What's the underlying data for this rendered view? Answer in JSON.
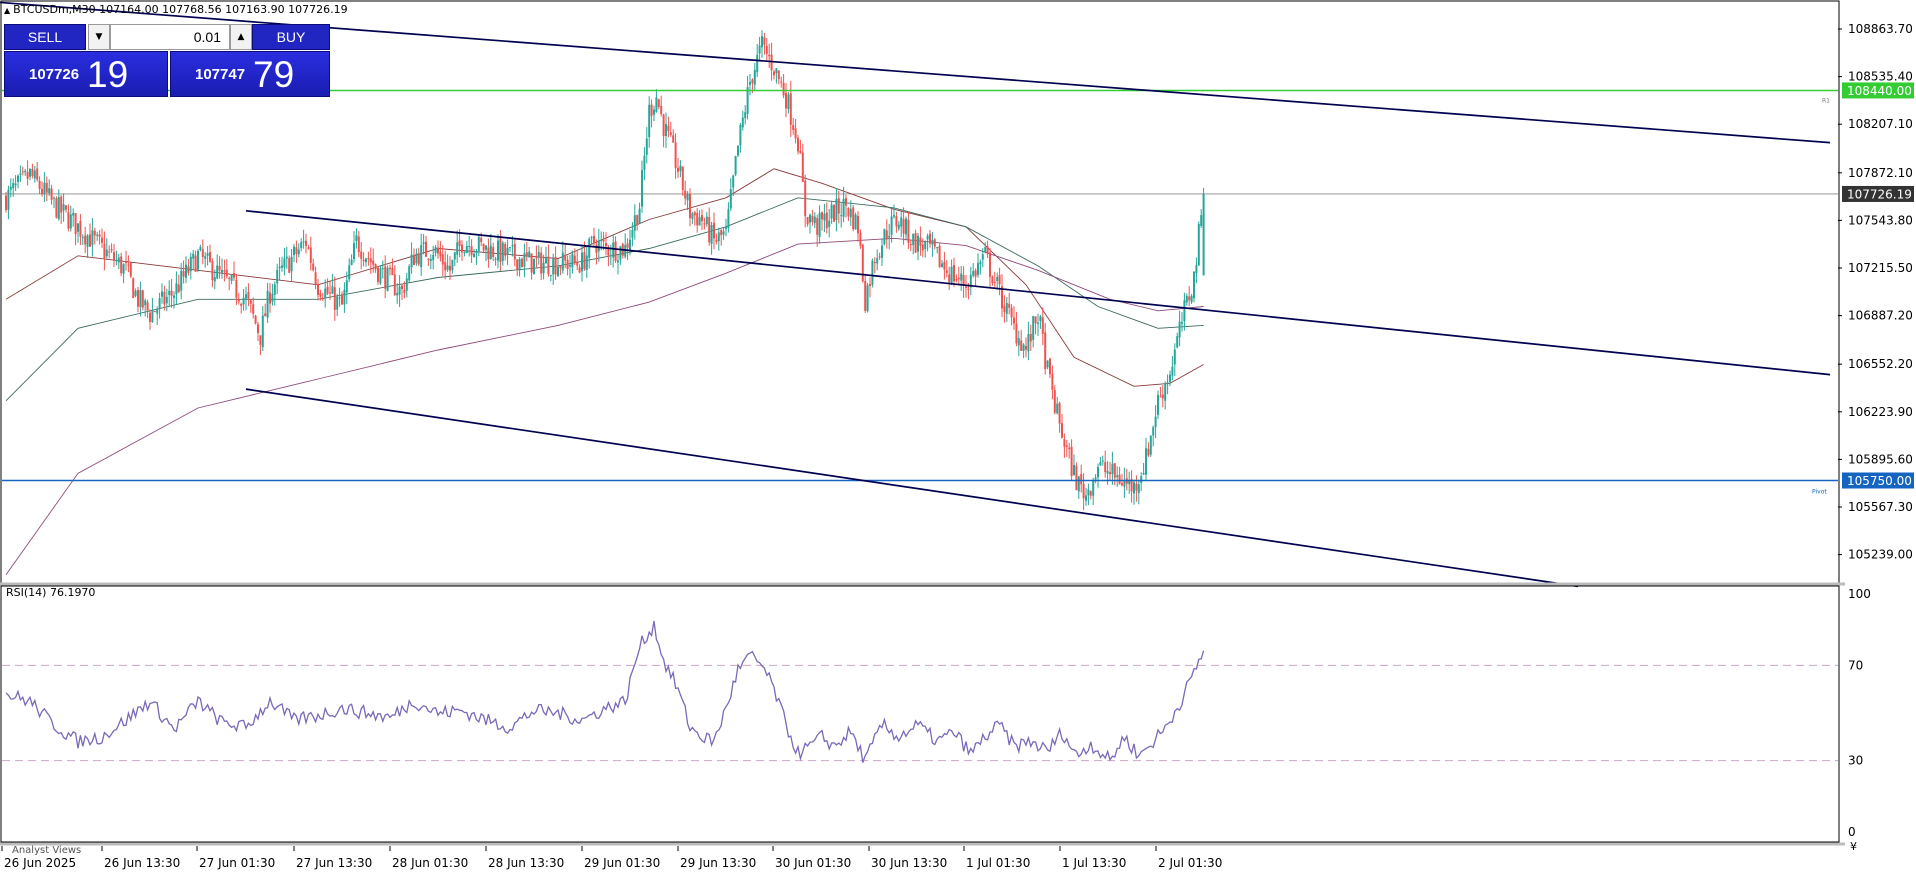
{
  "symbol_header": "BTCUSDm,M30  107164.00 107768.56 107163.90 107726.19",
  "trade_panel": {
    "sell_label": "SELL",
    "buy_label": "BUY",
    "lot": "0.01",
    "sell_price_main": "107726",
    "sell_price_big": "19",
    "buy_price_main": "107747",
    "buy_price_big": "79"
  },
  "indicator_label": "RSI(14) 76.1970",
  "bottom_tab": "Analyst Views",
  "price_axis_labels": [
    "108863.70",
    "108535.40",
    "108207.10",
    "107872.10",
    "107543.80",
    "107215.50",
    "106887.20",
    "106552.20",
    "106223.90",
    "105895.60",
    "105567.30",
    "105239.00"
  ],
  "rsi_axis_labels": [
    "100",
    "70",
    "30",
    "0"
  ],
  "time_axis_labels": [
    "26 Jun 2025",
    "26 Jun 13:30",
    "27 Jun 01:30",
    "27 Jun 13:30",
    "28 Jun 01:30",
    "28 Jun 13:30",
    "29 Jun 01:30",
    "29 Jun 13:30",
    "30 Jun 01:30",
    "30 Jun 13:30",
    "1 Jul 01:30",
    "1 Jul 13:30",
    "2 Jul 01:30"
  ],
  "current_price_label": "107726.19",
  "resistance_label": "108440.00",
  "pivot_label": "105750.00",
  "r1_tag": "R1",
  "pivot_tag": "Pivot",
  "colors": {
    "bull": "#26a69a",
    "bear": "#ef5350",
    "resistance": "#33cc33",
    "pivot": "#1565c0",
    "rsi": "#7b68b8",
    "channel": "#000050"
  },
  "chart_data": {
    "type": "candlestick",
    "symbol": "BTCUSDm",
    "timeframe": "M30",
    "ylim": [
      105050,
      109050
    ],
    "open": 107164.0,
    "high": 107768.56,
    "low": 107163.9,
    "close": 107726.19,
    "price_path": [
      [
        0,
        107700
      ],
      [
        10,
        107860
      ],
      [
        20,
        107650
      ],
      [
        30,
        107500
      ],
      [
        40,
        107350
      ],
      [
        50,
        107200
      ],
      [
        55,
        107000
      ],
      [
        60,
        106900
      ],
      [
        70,
        107050
      ],
      [
        80,
        107300
      ],
      [
        90,
        107150
      ],
      [
        100,
        107000
      ],
      [
        106,
        106750
      ],
      [
        110,
        107050
      ],
      [
        115,
        107200
      ],
      [
        125,
        107400
      ],
      [
        130,
        107100
      ],
      [
        140,
        106950
      ],
      [
        146,
        107400
      ],
      [
        155,
        107200
      ],
      [
        165,
        107050
      ],
      [
        170,
        107300
      ],
      [
        178,
        107350
      ],
      [
        185,
        107200
      ],
      [
        190,
        107400
      ],
      [
        200,
        107350
      ],
      [
        210,
        107300
      ],
      [
        220,
        107250
      ],
      [
        230,
        107250
      ],
      [
        240,
        107250
      ],
      [
        245,
        107400
      ],
      [
        250,
        107350
      ],
      [
        258,
        107350
      ],
      [
        264,
        107650
      ],
      [
        268,
        108300
      ],
      [
        271,
        108400
      ],
      [
        274,
        108200
      ],
      [
        280,
        107900
      ],
      [
        285,
        107600
      ],
      [
        290,
        107550
      ],
      [
        295,
        107400
      ],
      [
        300,
        107450
      ],
      [
        305,
        108050
      ],
      [
        310,
        108500
      ],
      [
        315,
        108750
      ],
      [
        320,
        108600
      ],
      [
        325,
        108400
      ],
      [
        330,
        108100
      ],
      [
        333,
        107600
      ],
      [
        338,
        107500
      ],
      [
        345,
        107600
      ],
      [
        350,
        107650
      ],
      [
        355,
        107500
      ],
      [
        358,
        107000
      ],
      [
        362,
        107300
      ],
      [
        368,
        107500
      ],
      [
        372,
        107550
      ],
      [
        378,
        107400
      ],
      [
        385,
        107350
      ],
      [
        392,
        107200
      ],
      [
        400,
        107100
      ],
      [
        408,
        107300
      ],
      [
        415,
        107000
      ],
      [
        420,
        106800
      ],
      [
        425,
        106650
      ],
      [
        430,
        106900
      ],
      [
        434,
        106500
      ],
      [
        438,
        106200
      ],
      [
        442,
        105950
      ],
      [
        446,
        105750
      ],
      [
        450,
        105650
      ],
      [
        455,
        105850
      ],
      [
        460,
        105800
      ],
      [
        465,
        105750
      ],
      [
        470,
        105700
      ],
      [
        475,
        105900
      ],
      [
        480,
        106300
      ],
      [
        485,
        106500
      ],
      [
        490,
        106850
      ],
      [
        495,
        107150
      ],
      [
        499,
        107726
      ]
    ],
    "rsi": [
      [
        0,
        58
      ],
      [
        10,
        55
      ],
      [
        20,
        45
      ],
      [
        30,
        38
      ],
      [
        40,
        40
      ],
      [
        50,
        47
      ],
      [
        60,
        55
      ],
      [
        70,
        43
      ],
      [
        80,
        55
      ],
      [
        90,
        46
      ],
      [
        100,
        44
      ],
      [
        110,
        55
      ],
      [
        120,
        47
      ],
      [
        130,
        49
      ],
      [
        140,
        52
      ],
      [
        150,
        50
      ],
      [
        160,
        48
      ],
      [
        170,
        55
      ],
      [
        180,
        50
      ],
      [
        190,
        51
      ],
      [
        200,
        47
      ],
      [
        210,
        44
      ],
      [
        220,
        51
      ],
      [
        230,
        50
      ],
      [
        240,
        47
      ],
      [
        250,
        52
      ],
      [
        258,
        55
      ],
      [
        264,
        78
      ],
      [
        270,
        87
      ],
      [
        274,
        72
      ],
      [
        280,
        60
      ],
      [
        285,
        44
      ],
      [
        290,
        40
      ],
      [
        295,
        38
      ],
      [
        300,
        52
      ],
      [
        305,
        68
      ],
      [
        310,
        74
      ],
      [
        315,
        70
      ],
      [
        320,
        60
      ],
      [
        325,
        45
      ],
      [
        330,
        33
      ],
      [
        335,
        36
      ],
      [
        340,
        40
      ],
      [
        345,
        36
      ],
      [
        352,
        42
      ],
      [
        358,
        30
      ],
      [
        365,
        45
      ],
      [
        372,
        40
      ],
      [
        380,
        45
      ],
      [
        388,
        38
      ],
      [
        395,
        42
      ],
      [
        402,
        33
      ],
      [
        408,
        40
      ],
      [
        414,
        45
      ],
      [
        420,
        36
      ],
      [
        427,
        38
      ],
      [
        434,
        34
      ],
      [
        440,
        42
      ],
      [
        446,
        32
      ],
      [
        452,
        37
      ],
      [
        460,
        30
      ],
      [
        466,
        40
      ],
      [
        472,
        32
      ],
      [
        478,
        38
      ],
      [
        484,
        45
      ],
      [
        490,
        56
      ],
      [
        495,
        67
      ],
      [
        499,
        76.197
      ]
    ],
    "levels": {
      "resistance": 108440.0,
      "pivot": 105750.0,
      "current": 107726.19
    },
    "rsi_levels": [
      70,
      30
    ],
    "rsi_ylim": [
      0,
      100
    ],
    "channel_lines": [
      {
        "from": [
          -5,
          109050
        ],
        "to": [
          760,
          108080
        ]
      },
      {
        "from": [
          100,
          107610
        ],
        "to": [
          760,
          106480
        ]
      },
      {
        "from": [
          100,
          106380
        ],
        "to": [
          655,
          105020
        ]
      }
    ],
    "moving_averages": {
      "fast": [
        [
          0,
          107000
        ],
        [
          30,
          107300
        ],
        [
          80,
          107200
        ],
        [
          130,
          107100
        ],
        [
          180,
          107350
        ],
        [
          230,
          107280
        ],
        [
          268,
          107550
        ],
        [
          300,
          107700
        ],
        [
          320,
          107900
        ],
        [
          340,
          107800
        ],
        [
          370,
          107620
        ],
        [
          400,
          107500
        ],
        [
          425,
          107100
        ],
        [
          445,
          106600
        ],
        [
          470,
          106400
        ],
        [
          485,
          106420
        ],
        [
          499,
          106550
        ]
      ],
      "medium": [
        [
          0,
          106300
        ],
        [
          30,
          106800
        ],
        [
          80,
          107000
        ],
        [
          130,
          107000
        ],
        [
          180,
          107150
        ],
        [
          230,
          107230
        ],
        [
          268,
          107350
        ],
        [
          300,
          107500
        ],
        [
          330,
          107700
        ],
        [
          370,
          107630
        ],
        [
          400,
          107500
        ],
        [
          430,
          107230
        ],
        [
          455,
          106950
        ],
        [
          480,
          106800
        ],
        [
          499,
          106820
        ]
      ],
      "slow": [
        [
          0,
          105100
        ],
        [
          30,
          105800
        ],
        [
          80,
          106250
        ],
        [
          130,
          106450
        ],
        [
          180,
          106650
        ],
        [
          230,
          106820
        ],
        [
          268,
          106980
        ],
        [
          300,
          107180
        ],
        [
          330,
          107380
        ],
        [
          370,
          107420
        ],
        [
          400,
          107370
        ],
        [
          430,
          107200
        ],
        [
          460,
          107000
        ],
        [
          480,
          106920
        ],
        [
          499,
          106950
        ]
      ]
    }
  }
}
